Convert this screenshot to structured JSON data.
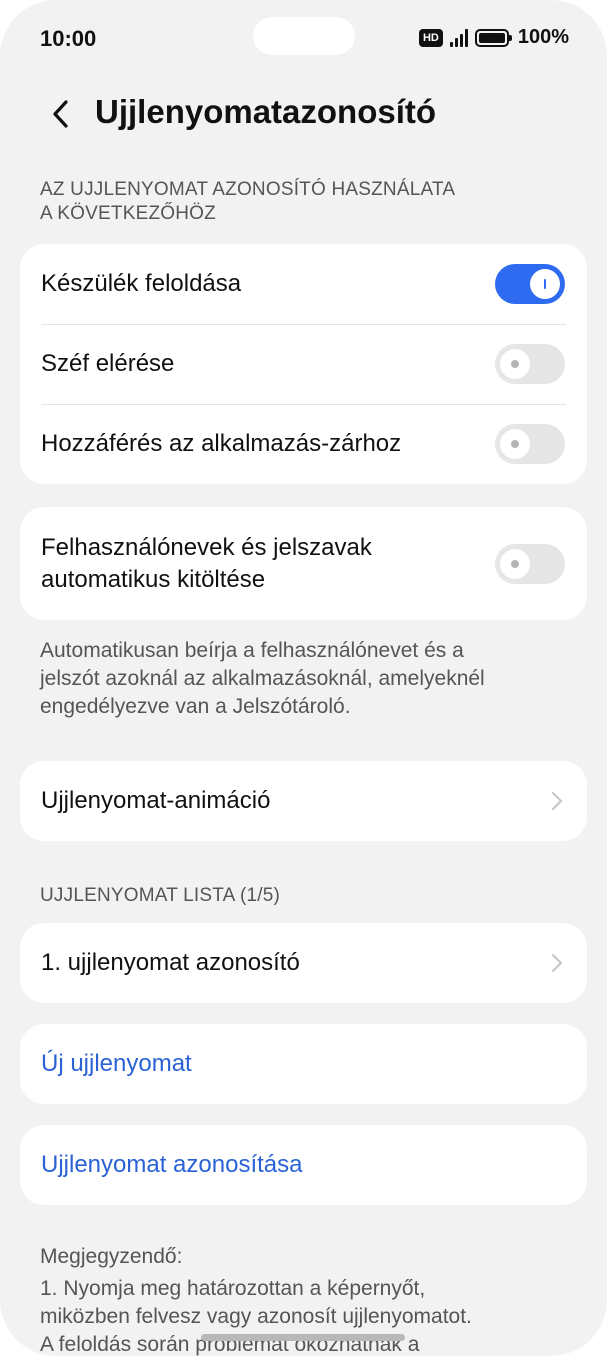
{
  "status_bar": {
    "time": "10:00",
    "hd_badge": "HD",
    "battery": "100%"
  },
  "header": {
    "title": "Ujjlenyomatazonosító"
  },
  "usage_section": {
    "title_line1": "AZ UJJLENYOMAT AZONOSÍTÓ HASZNÁLATA",
    "title_line2": "A KÖVETKEZŐHÖZ",
    "items": [
      {
        "label": "Készülék feloldása",
        "enabled": true
      },
      {
        "label": "Széf elérése",
        "enabled": false
      },
      {
        "label": "Hozzáférés az alkalmazás-zárhoz",
        "enabled": false
      }
    ]
  },
  "autofill": {
    "label_line1": "Felhasználónevek és jelszavak",
    "label_line2": "automatikus kitöltése",
    "enabled": false,
    "description_line1": "Automatikusan beírja a felhasználónevet és a",
    "description_line2": "jelszót azoknál az alkalmazásoknál, amelyeknél",
    "description_line3": "engedélyezve van a Jelszótároló."
  },
  "animation": {
    "label": "Ujjlenyomat-animáció"
  },
  "fingerprint_list": {
    "title": "UJJLENYOMAT LISTA (1/5)",
    "items": [
      {
        "label": "1. ujjlenyomat azonosító"
      }
    ]
  },
  "actions": {
    "new_fingerprint": "Új ujjlenyomat",
    "identify_fingerprint": "Ujjlenyomat azonosítása"
  },
  "notes": {
    "title": "Megjegyzendő:",
    "line1": "1. Nyomja meg határozottan a képernyőt,",
    "line2": "miközben felvesz vagy azonosít ujjlenyomatot.",
    "line3": "A feloldás során problémát okozhatnak a"
  },
  "colors": {
    "accent": "#2f6bf0",
    "link": "#2a62d6",
    "background": "#f2f2f2"
  }
}
